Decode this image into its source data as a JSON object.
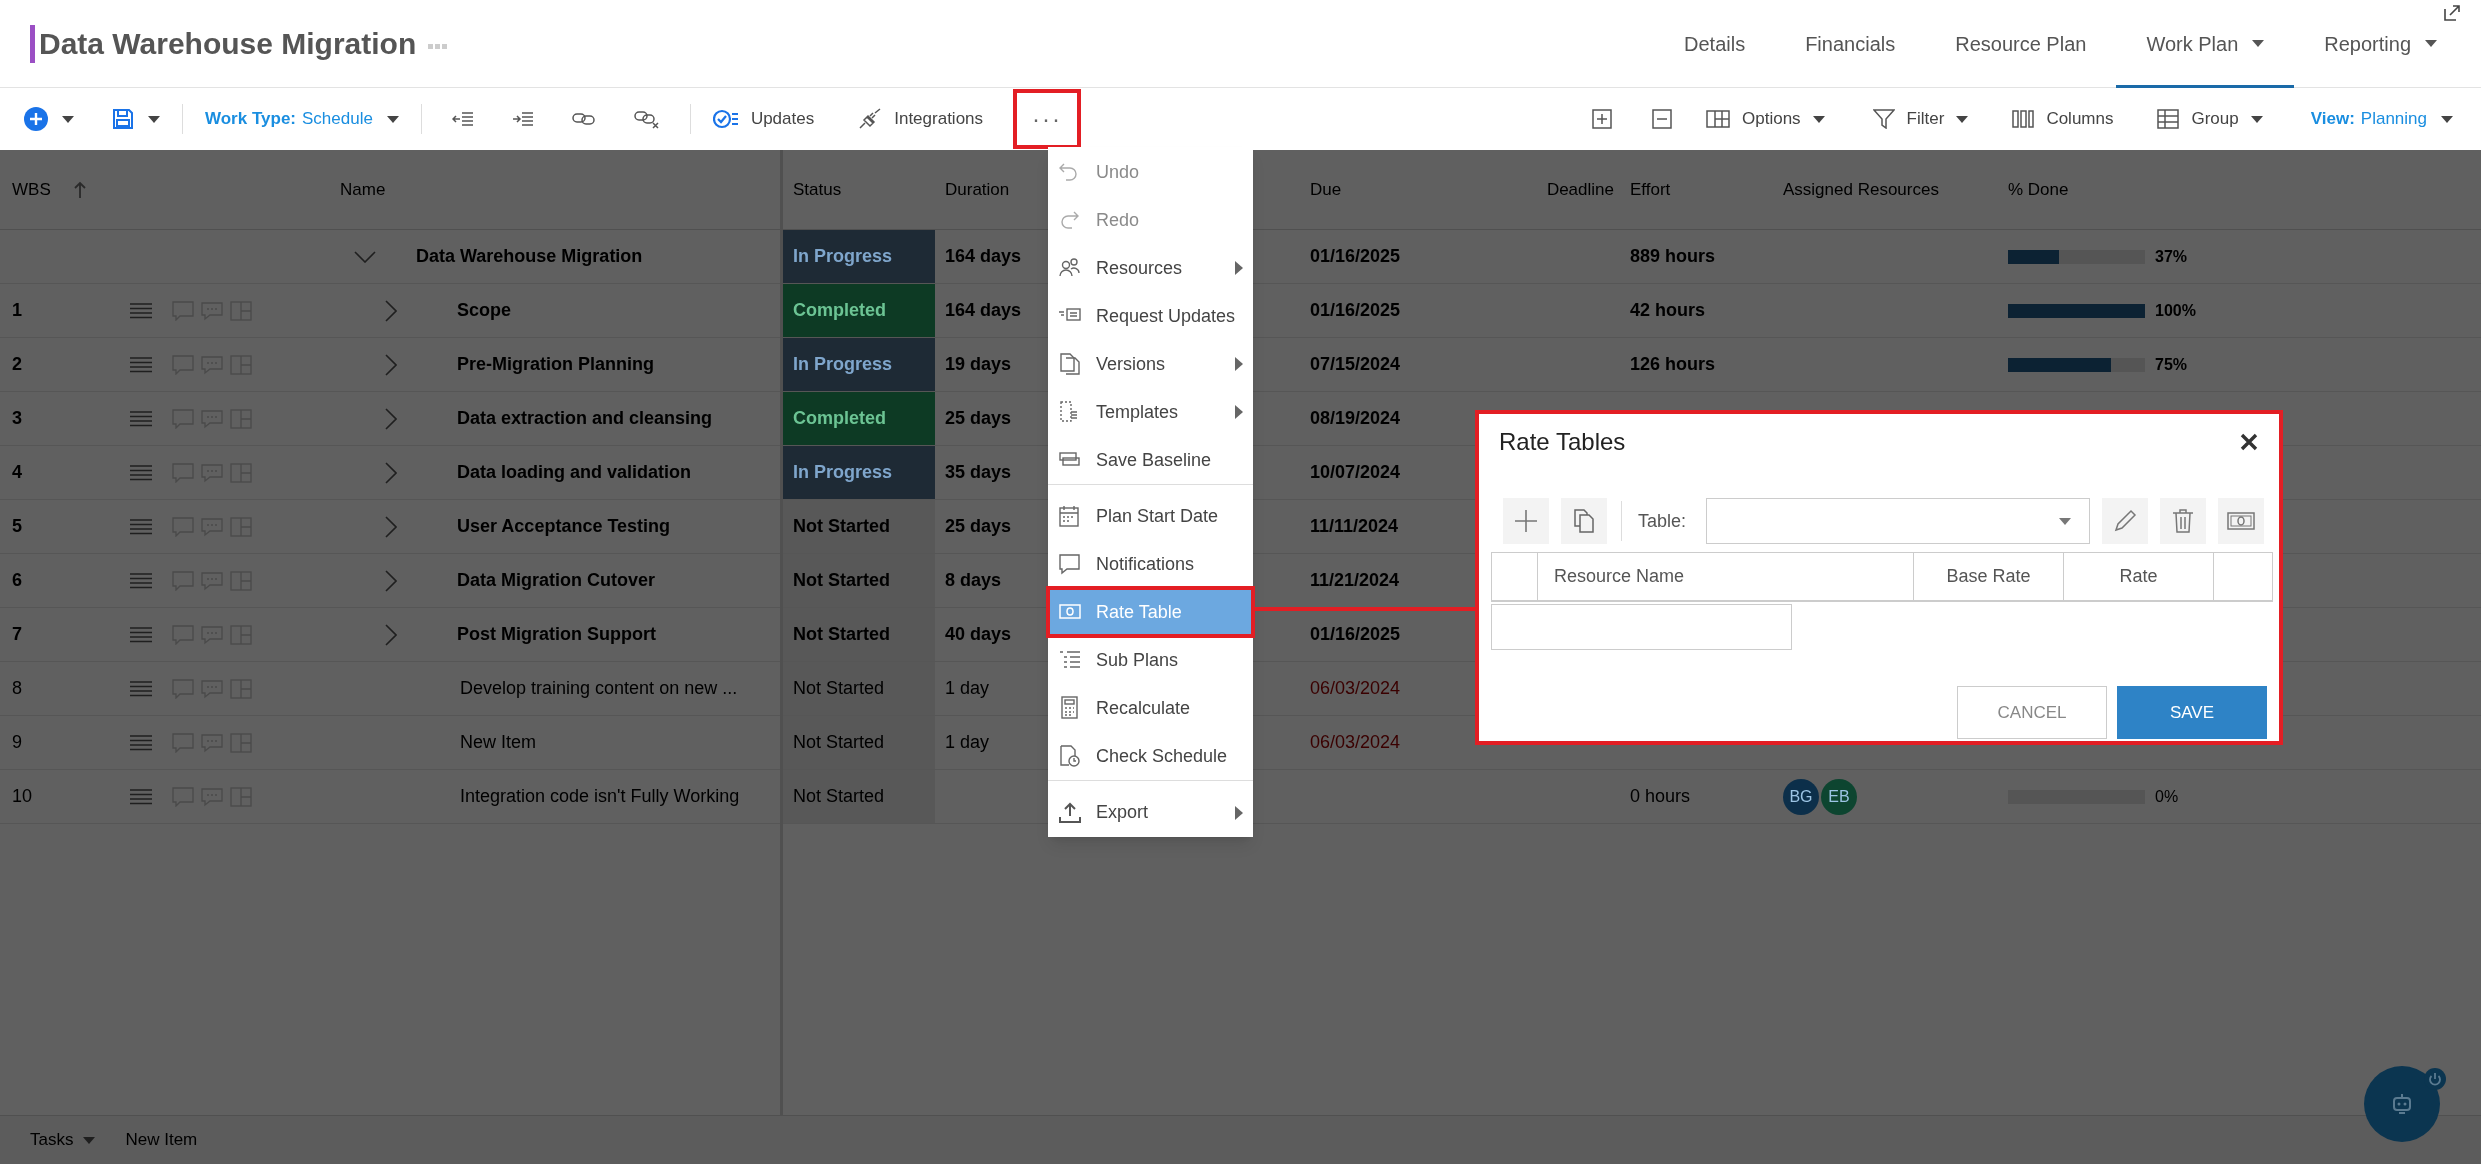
{
  "header": {
    "title": "Data Warehouse Migration",
    "tabs": [
      {
        "label": "Details",
        "selected": false,
        "dropdown": false
      },
      {
        "label": "Financials",
        "selected": false,
        "dropdown": false
      },
      {
        "label": "Resource Plan",
        "selected": false,
        "dropdown": false
      },
      {
        "label": "Work Plan",
        "selected": true,
        "dropdown": true
      },
      {
        "label": "Reporting",
        "selected": false,
        "dropdown": true
      }
    ]
  },
  "toolbar": {
    "work_type": {
      "label": "Work Type:",
      "value": "Schedule"
    },
    "updates": "Updates",
    "integrations": "Integrations",
    "more": {
      "label": "···",
      "highlighted": true
    },
    "options": "Options",
    "filter": "Filter",
    "columns": "Columns",
    "group": "Group",
    "view": {
      "label": "View:",
      "value": "Planning"
    }
  },
  "grid": {
    "columns": [
      "WBS",
      "Name",
      "Status",
      "Duration",
      "Due",
      "Deadline",
      "Effort",
      "Assigned Resources",
      "% Done"
    ],
    "rows": [
      {
        "kind": "root",
        "expanded": true,
        "name": "Data Warehouse Migration",
        "status": {
          "label": "In Progress",
          "kind": "in_progress"
        },
        "duration": "164 days",
        "due": "01/16/2025",
        "overdue": false,
        "effort": "889 hours",
        "level": 0.37,
        "percent": "37%"
      },
      {
        "kind": "parent",
        "expanded": false,
        "wbs": "1",
        "name": "Scope",
        "status": {
          "label": "Completed",
          "kind": "completed"
        },
        "duration": "164 days",
        "due": "01/16/2025",
        "overdue": false,
        "effort": "42 hours",
        "level": 1,
        "percent": "100%"
      },
      {
        "kind": "parent",
        "expanded": false,
        "wbs": "2",
        "name": "Pre-Migration Planning",
        "status": {
          "label": "In Progress",
          "kind": "in_progress"
        },
        "duration": "19 days",
        "due": "07/15/2024",
        "overdue": false,
        "effort": "126 hours",
        "level": 0.75,
        "percent": "75%"
      },
      {
        "kind": "parent",
        "expanded": false,
        "wbs": "3",
        "name": "Data extraction and cleansing",
        "status": {
          "label": "Completed",
          "kind": "completed"
        },
        "duration": "25 days",
        "due": "08/19/2024",
        "overdue": false
      },
      {
        "kind": "parent",
        "expanded": false,
        "wbs": "4",
        "name": "Data loading and validation",
        "status": {
          "label": "In Progress",
          "kind": "in_progress"
        },
        "duration": "35 days",
        "due": "10/07/2024",
        "overdue": false
      },
      {
        "kind": "parent",
        "expanded": false,
        "wbs": "5",
        "name": "User Acceptance Testing",
        "status": {
          "label": "Not Started",
          "kind": "not_started"
        },
        "duration": "25 days",
        "due": "11/11/2024",
        "overdue": false
      },
      {
        "kind": "parent",
        "expanded": false,
        "wbs": "6",
        "name": "Data Migration Cutover",
        "status": {
          "label": "Not Started",
          "kind": "not_started"
        },
        "duration": "8 days",
        "due": "11/21/2024",
        "overdue": false
      },
      {
        "kind": "parent",
        "expanded": false,
        "wbs": "7",
        "name": "Post Migration Support",
        "status": {
          "label": "Not Started",
          "kind": "not_started"
        },
        "duration": "40 days",
        "due": "01/16/2025",
        "overdue": false
      },
      {
        "kind": "task",
        "wbs": "8",
        "name": "Develop training content on new ...",
        "status": {
          "label": "Not Started",
          "kind": "not_started"
        },
        "duration": "1 day",
        "due": "06/03/2024",
        "overdue": true
      },
      {
        "kind": "task",
        "wbs": "9",
        "name": "New Item",
        "status": {
          "label": "Not Started",
          "kind": "not_started"
        },
        "duration": "1 day",
        "due": "06/03/2024",
        "overdue": true
      },
      {
        "kind": "task",
        "wbs": "10",
        "name": "Integration code isn't Fully Working",
        "status": {
          "label": "Not Started",
          "kind": "not_started"
        },
        "effort": "0 hours",
        "resources": [
          {
            "initials": "BG",
            "color": "#0c2f4a"
          },
          {
            "initials": "EB",
            "color": "#0d4530"
          }
        ],
        "level": 0,
        "percent": "0%"
      }
    ]
  },
  "menu": {
    "items": [
      {
        "label": "Undo",
        "disabled": true,
        "submenu": false,
        "selected": false,
        "highlighted": false,
        "divider_before": false
      },
      {
        "label": "Redo",
        "disabled": true,
        "submenu": false,
        "selected": false,
        "highlighted": false,
        "divider_before": false
      },
      {
        "label": "Resources",
        "disabled": false,
        "submenu": true,
        "selected": false,
        "highlighted": false,
        "divider_before": false
      },
      {
        "label": "Request Updates",
        "disabled": false,
        "submenu": false,
        "selected": false,
        "highlighted": false,
        "divider_before": false
      },
      {
        "label": "Versions",
        "disabled": false,
        "submenu": true,
        "selected": false,
        "highlighted": false,
        "divider_before": false
      },
      {
        "label": "Templates",
        "disabled": false,
        "submenu": true,
        "selected": false,
        "highlighted": false,
        "divider_before": false
      },
      {
        "label": "Save Baseline",
        "disabled": false,
        "submenu": false,
        "selected": false,
        "highlighted": false,
        "divider_before": false
      },
      {
        "label": "Plan Start Date",
        "disabled": false,
        "submenu": false,
        "selected": false,
        "highlighted": false,
        "divider_before": true
      },
      {
        "label": "Notifications",
        "disabled": false,
        "submenu": false,
        "selected": false,
        "highlighted": false,
        "divider_before": false
      },
      {
        "label": "Rate Table",
        "disabled": false,
        "submenu": false,
        "selected": true,
        "highlighted": true,
        "divider_before": false
      },
      {
        "label": "Sub Plans",
        "disabled": false,
        "submenu": false,
        "selected": false,
        "highlighted": false,
        "divider_before": false
      },
      {
        "label": "Recalculate",
        "disabled": false,
        "submenu": false,
        "selected": false,
        "highlighted": false,
        "divider_before": false
      },
      {
        "label": "Check Schedule",
        "disabled": false,
        "submenu": false,
        "selected": false,
        "highlighted": false,
        "divider_before": false
      },
      {
        "label": "Export",
        "disabled": false,
        "submenu": true,
        "selected": false,
        "highlighted": false,
        "divider_before": true
      }
    ]
  },
  "dialog": {
    "title": "Rate Tables",
    "highlighted": true,
    "table_label": "Table:",
    "columns": [
      "Resource Name",
      "Base Rate",
      "Rate"
    ],
    "cancel": "CANCEL",
    "save": "SAVE"
  },
  "footer": {
    "tab": "Tasks",
    "new_item": "New Item"
  }
}
